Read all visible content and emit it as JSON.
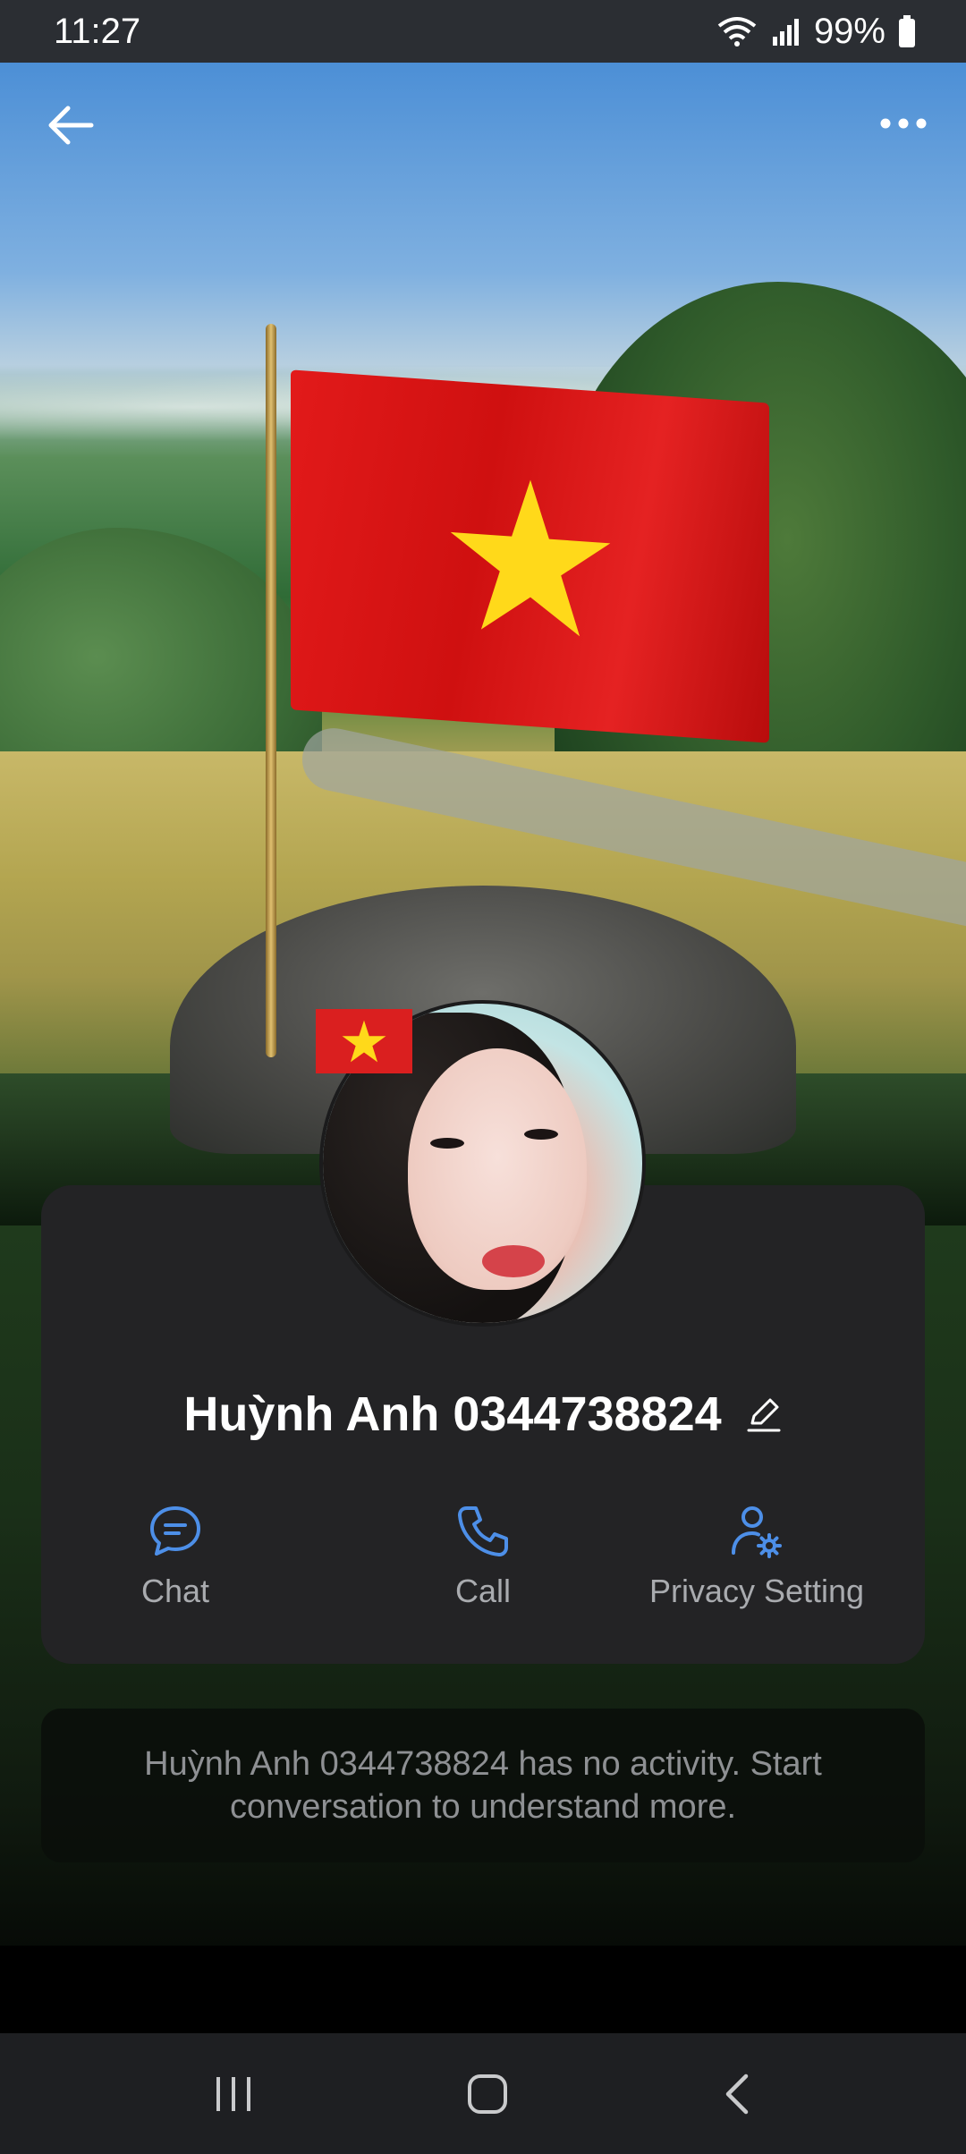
{
  "status_bar": {
    "time": "11:27",
    "battery": "99%"
  },
  "header": {
    "back_icon": "back-arrow-icon",
    "more_icon": "more-dots-icon"
  },
  "profile": {
    "name": "Huỳnh Anh 0344738824",
    "edit_icon": "pencil-icon",
    "badge": "vietnam-flag-badge"
  },
  "actions": [
    {
      "label": "Chat",
      "icon": "chat-bubble-icon"
    },
    {
      "label": "Call",
      "icon": "phone-icon"
    },
    {
      "label": "Privacy Setting",
      "icon": "user-gear-icon"
    }
  ],
  "activity": {
    "message": "Huỳnh Anh 0344738824 has no activity. Start conversation to understand more."
  },
  "colors": {
    "accent": "#4d8fe8",
    "card": "#232325",
    "flag_red": "#da1f1f",
    "flag_star": "#ffd91a"
  }
}
